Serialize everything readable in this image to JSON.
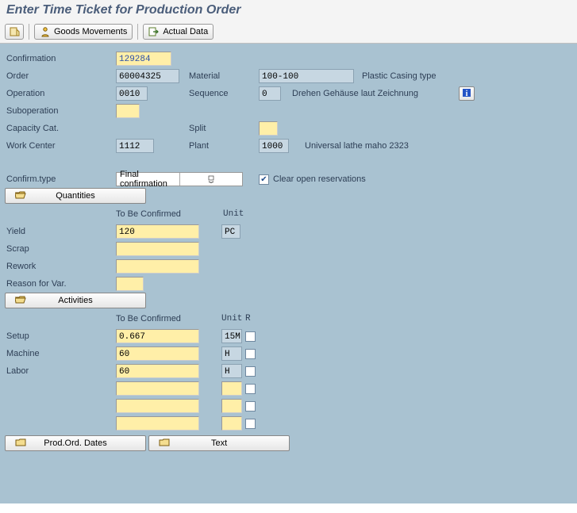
{
  "title": "Enter Time Ticket for Production Order",
  "toolbar": {
    "goods_movements": "Goods Movements",
    "actual_data": "Actual Data"
  },
  "labels": {
    "confirmation": "Confirmation",
    "order": "Order",
    "material": "Material",
    "operation": "Operation",
    "sequence": "Sequence",
    "suboperation": "Suboperation",
    "capacity_cat": "Capacity Cat.",
    "split": "Split",
    "work_center": "Work Center",
    "plant": "Plant",
    "confirm_type": "Confirm.type",
    "clear_open_res": "Clear open reservations",
    "quantities": "Quantities",
    "to_be_confirmed": "To Be Confirmed",
    "unit": "Unit",
    "yield": "Yield",
    "scrap": "Scrap",
    "rework": "Rework",
    "reason_for_var": "Reason for Var.",
    "activities": "Activities",
    "r": "R",
    "setup": "Setup",
    "machine": "Machine",
    "labor": "Labor",
    "prod_ord_dates": "Prod.Ord. Dates",
    "text": "Text"
  },
  "fields": {
    "confirmation": "129284",
    "order": "60004325",
    "material": "100-100",
    "material_desc": "Plastic Casing type",
    "operation": "0010",
    "sequence": "0",
    "operation_desc": "Drehen Gehäuse laut Zeichnung",
    "suboperation": "",
    "capacity_cat": "",
    "split": "",
    "work_center": "1112",
    "plant": "1000",
    "plant_desc": "Universal lathe maho 2323",
    "confirm_type": "Final confirmation",
    "clear_open_res_checked": true
  },
  "quantities": {
    "yield": {
      "value": "120",
      "unit": "PC"
    },
    "scrap": {
      "value": "",
      "unit": ""
    },
    "rework": {
      "value": "",
      "unit": ""
    },
    "reason_for_var": ""
  },
  "activities": [
    {
      "label": "Setup",
      "value": "0.667",
      "unit": "15M",
      "r": false
    },
    {
      "label": "Machine",
      "value": "60",
      "unit": "H",
      "r": false
    },
    {
      "label": "Labor",
      "value": "60",
      "unit": "H",
      "r": false
    },
    {
      "label": "",
      "value": "",
      "unit": "",
      "r": false
    },
    {
      "label": "",
      "value": "",
      "unit": "",
      "r": false
    },
    {
      "label": "",
      "value": "",
      "unit": "",
      "r": false
    }
  ]
}
